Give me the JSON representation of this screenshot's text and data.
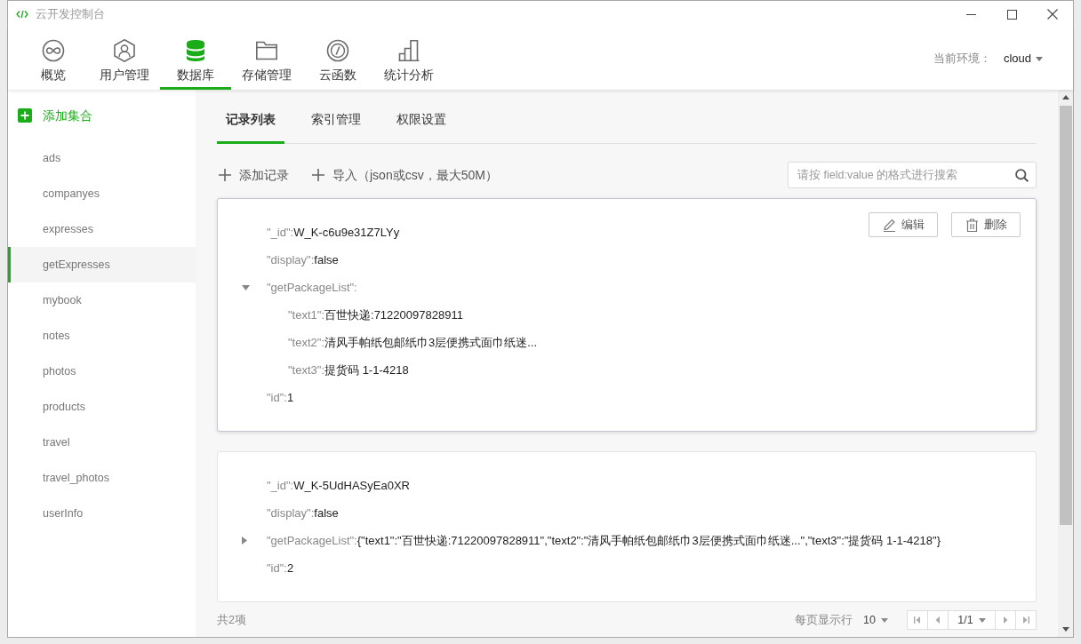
{
  "window": {
    "title": "云开发控制台"
  },
  "nav": [
    {
      "kind": "overview",
      "label": "概览",
      "selected": false
    },
    {
      "kind": "users",
      "label": "用户管理",
      "selected": false
    },
    {
      "kind": "database",
      "label": "数据库",
      "selected": true
    },
    {
      "kind": "storage",
      "label": "存储管理",
      "selected": false
    },
    {
      "kind": "functions",
      "label": "云函数",
      "selected": false
    },
    {
      "kind": "analytics",
      "label": "统计分析",
      "selected": false
    }
  ],
  "environment": {
    "label": "当前环境：",
    "value": "cloud"
  },
  "sidebar": {
    "add_button": "添加集合",
    "items": [
      {
        "label": "ads",
        "selected": false
      },
      {
        "label": "companyes",
        "selected": false
      },
      {
        "label": "expresses",
        "selected": false
      },
      {
        "label": "getExpresses",
        "selected": true
      },
      {
        "label": "mybook",
        "selected": false
      },
      {
        "label": "notes",
        "selected": false
      },
      {
        "label": "photos",
        "selected": false
      },
      {
        "label": "products",
        "selected": false
      },
      {
        "label": "travel",
        "selected": false
      },
      {
        "label": "travel_photos",
        "selected": false
      },
      {
        "label": "userInfo",
        "selected": false
      }
    ]
  },
  "tabs": [
    {
      "label": "记录列表",
      "selected": true
    },
    {
      "label": "索引管理",
      "selected": false
    },
    {
      "label": "权限设置",
      "selected": false
    }
  ],
  "toolbar": {
    "add_record": "添加记录",
    "import": "导入（json或csv，最大50M）",
    "search": {
      "placeholder": "请按 field:value 的格式进行搜索"
    }
  },
  "records": [
    {
      "highlighted": true,
      "actions": [
        {
          "kind": "edit",
          "label": "编辑"
        },
        {
          "kind": "delete",
          "label": "删除"
        }
      ],
      "fields": [
        {
          "key": "\"_id\":",
          "value": "W_K-c6u9e31Z7LYy"
        },
        {
          "key": "\"display\":",
          "value": "false"
        },
        {
          "key": "\"getPackageList\":",
          "expanded": true,
          "children": [
            {
              "key": "\"text1\":",
              "value": "百世快递:71220097828911"
            },
            {
              "key": "\"text2\":",
              "value": "清风手帕纸包邮纸巾3层便携式面巾纸迷..."
            },
            {
              "key": "\"text3\":",
              "value": "提货码 1-1-4218"
            }
          ]
        },
        {
          "key": "\"id\":",
          "value": "1"
        }
      ]
    },
    {
      "highlighted": false,
      "fields": [
        {
          "key": "\"_id\":",
          "value": "W_K-5UdHASyEa0XR"
        },
        {
          "key": "\"display\":",
          "value": "false"
        },
        {
          "key": "\"getPackageList\":",
          "expanded": false,
          "value": "{\"text1\":\"百世快递:71220097828911\",\"text2\":\"清风手帕纸包邮纸巾3层便携式面巾纸迷...\",\"text3\":\"提货码 1-1-4218\"}"
        },
        {
          "key": "\"id\":",
          "value": "2"
        }
      ]
    }
  ],
  "footer": {
    "total": "共2项",
    "page_size_label": "每页显示行",
    "page_size": "10",
    "page": "1/1"
  }
}
